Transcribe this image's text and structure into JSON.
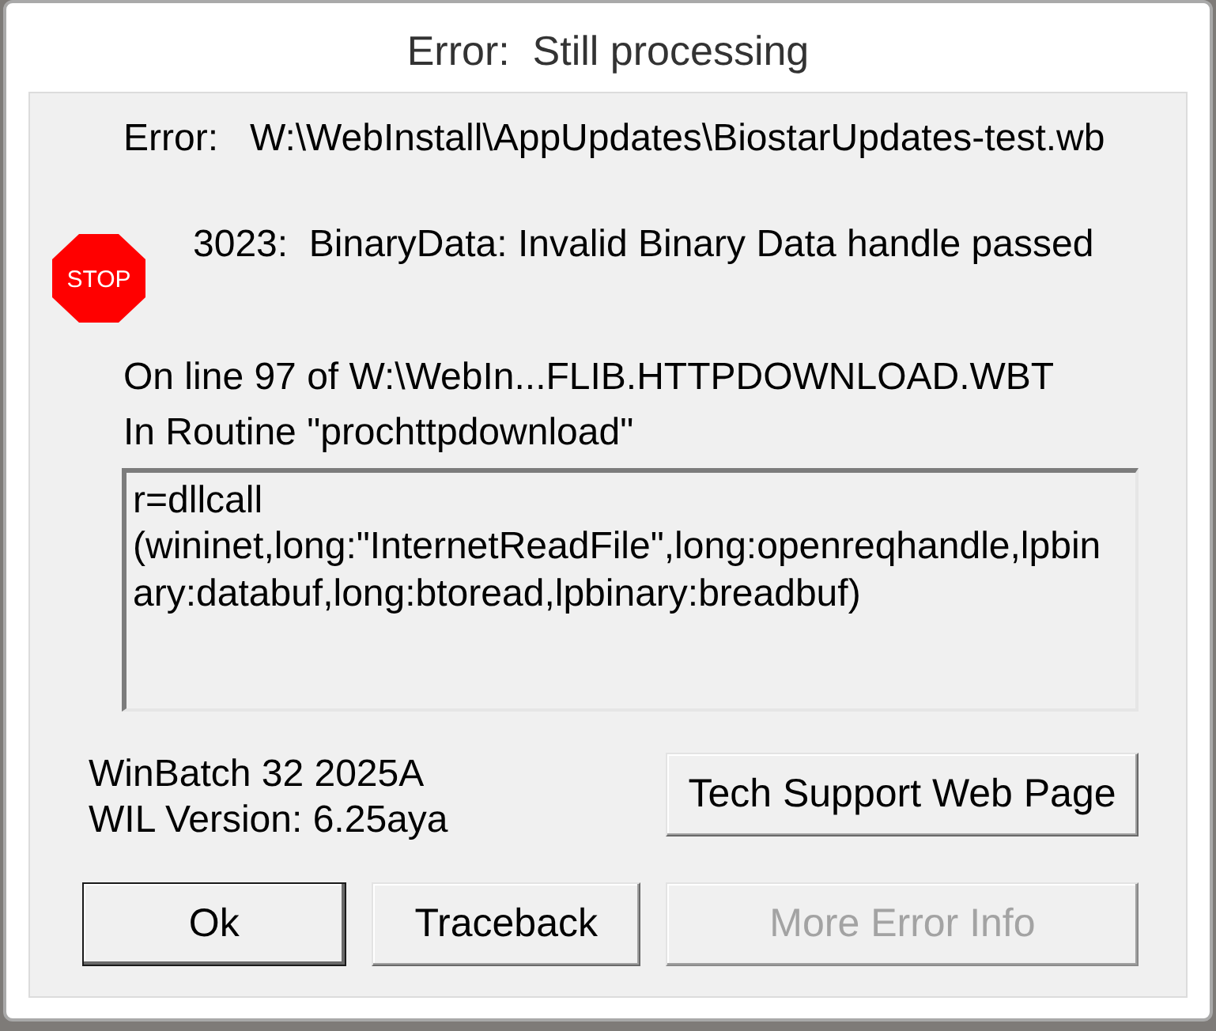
{
  "window": {
    "title": "Error:  Still processing"
  },
  "error": {
    "label": "Error:",
    "file": "W:\\WebInstall\\AppUpdates\\BiostarUpdates-test.wb"
  },
  "message": {
    "icon_label": "STOP",
    "text": "3023:  BinaryData: Invalid Binary Data handle passed"
  },
  "location": {
    "line": "On line 97 of W:\\WebIn...FLIB.HTTPDOWNLOAD.WBT",
    "routine": "In Routine \"prochttpdownload\""
  },
  "code": {
    "lines": [
      "r=dllcall",
      "(wininet,long:\"InternetReadFile\",long:openreqhandle,lpbin",
      "ary:databuf,long:btoread,lpbinary:breadbuf)"
    ]
  },
  "version": {
    "product": "WinBatch 32 2025A",
    "wil": "WIL Version: 6.25aya"
  },
  "support_button": {
    "label": "Tech Support Web Page"
  },
  "buttons": [
    {
      "label": "Ok",
      "default": true,
      "disabled": false
    },
    {
      "label": "Traceback",
      "default": false,
      "disabled": false
    },
    {
      "label": "More Error Info",
      "default": false,
      "disabled": true
    }
  ]
}
